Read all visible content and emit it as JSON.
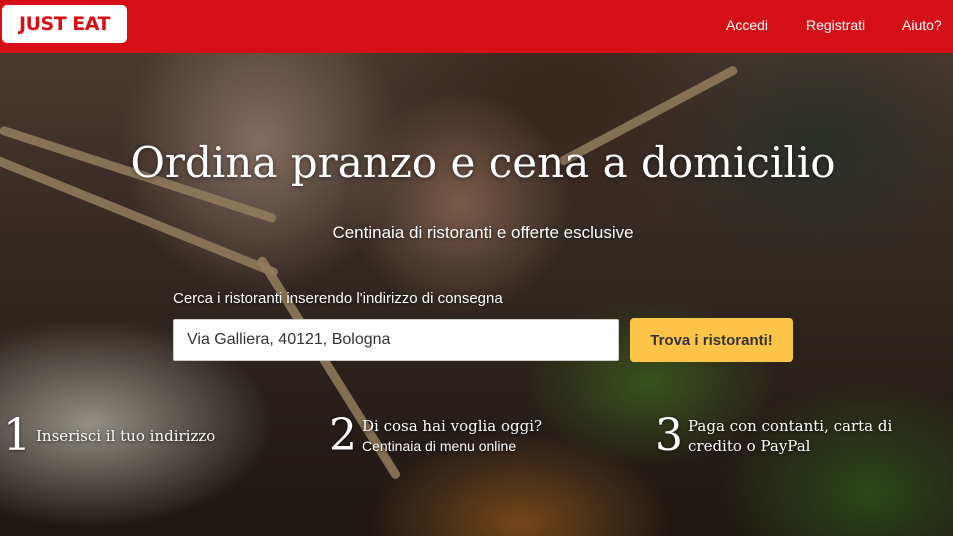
{
  "header": {
    "logo_text": "JUST EAT",
    "nav": [
      {
        "label": "Accedi"
      },
      {
        "label": "Registrati"
      },
      {
        "label": "Aiuto?"
      }
    ]
  },
  "hero": {
    "title": "Ordina pranzo e cena a domicilio",
    "subtitle": "Centinaia di ristoranti e offerte esclusive"
  },
  "search": {
    "label": "Cerca i ristoranti inserendo l'indirizzo di consegna",
    "value": "Via Galliera, 40121, Bologna",
    "button_label": "Trova i ristoranti!"
  },
  "steps": [
    {
      "number": "1",
      "title": "Inserisci il tuo indirizzo",
      "subtitle": ""
    },
    {
      "number": "2",
      "title": "Di cosa hai voglia oggi?",
      "subtitle": "Centinaia di menu online"
    },
    {
      "number": "3",
      "title": "Paga con contanti, carta di credito o PayPal",
      "subtitle": ""
    }
  ],
  "colors": {
    "brand_red": "#d50f16",
    "button_yellow": "#fec54a"
  }
}
